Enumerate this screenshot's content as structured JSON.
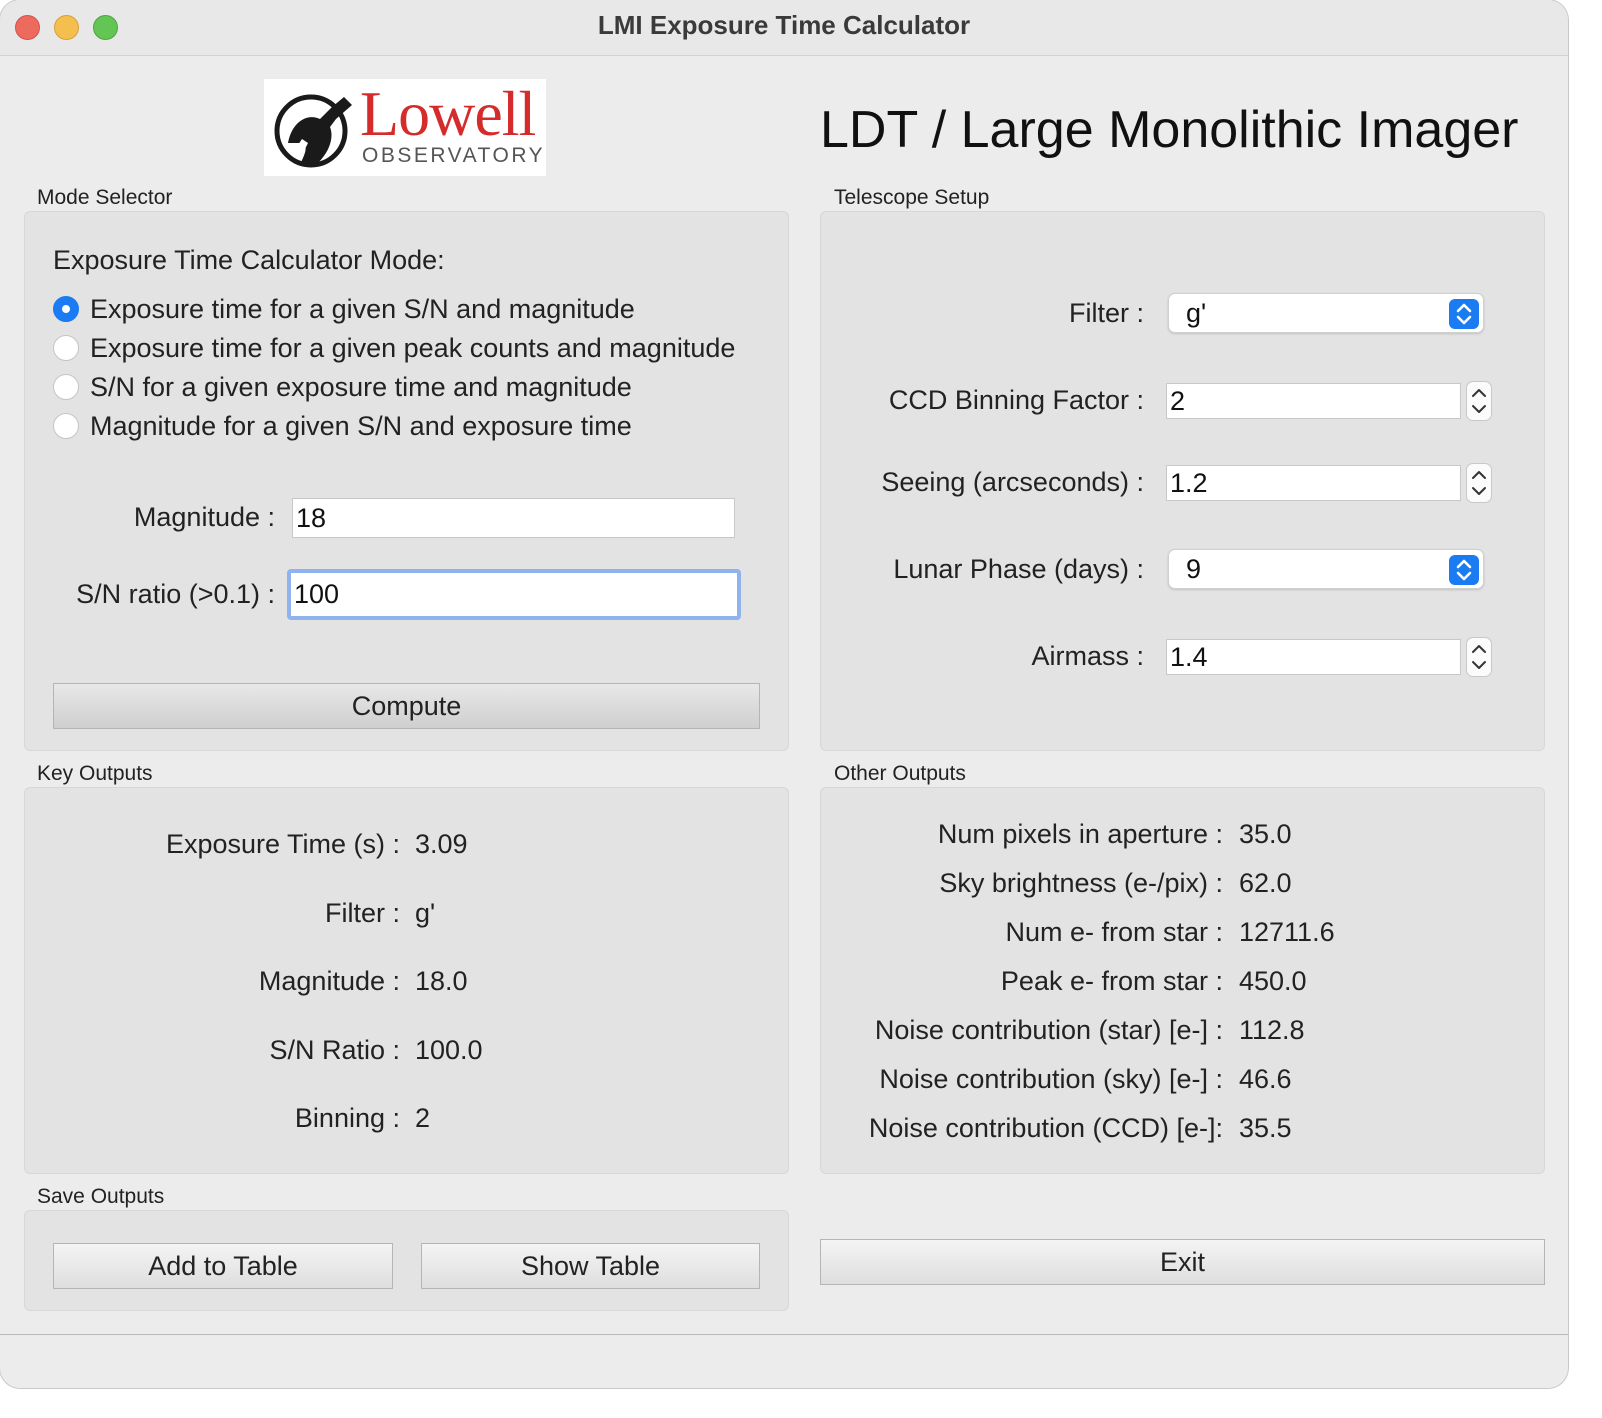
{
  "window": {
    "title": "LMI Exposure Time Calculator"
  },
  "header": {
    "logo_word": "Lowell",
    "logo_sub": "OBSERVATORY",
    "heading": "LDT / Large Monolithic Imager"
  },
  "mode_selector": {
    "group_label": "Mode Selector",
    "title": "Exposure Time Calculator Mode:",
    "options": [
      {
        "label": "Exposure time for a given S/N and magnitude",
        "checked": true
      },
      {
        "label": "Exposure time for a given peak counts and magnitude",
        "checked": false
      },
      {
        "label": "S/N for a given exposure time and magnitude",
        "checked": false
      },
      {
        "label": "Magnitude for a given S/N and exposure time",
        "checked": false
      }
    ],
    "magnitude_label": "Magnitude :",
    "magnitude_value": "18",
    "sn_label": "S/N ratio (>0.1) :",
    "sn_value": "100",
    "compute_label": "Compute"
  },
  "telescope_setup": {
    "group_label": "Telescope Setup",
    "filter_label": "Filter :",
    "filter_value": "g'",
    "binning_label": "CCD Binning Factor :",
    "binning_value": "2",
    "seeing_label": "Seeing (arcseconds) :",
    "seeing_value": "1.2",
    "lunar_label": "Lunar Phase (days) :",
    "lunar_value": "9",
    "airmass_label": "Airmass :",
    "airmass_value": "1.4"
  },
  "key_outputs": {
    "group_label": "Key Outputs",
    "rows": [
      {
        "label": "Exposure Time (s) :",
        "value": "3.09"
      },
      {
        "label": "Filter :",
        "value": "g'"
      },
      {
        "label": "Magnitude :",
        "value": "18.0"
      },
      {
        "label": "S/N Ratio :",
        "value": "100.0"
      },
      {
        "label": "Binning :",
        "value": "2"
      }
    ]
  },
  "other_outputs": {
    "group_label": "Other Outputs",
    "rows": [
      {
        "label": "Num pixels in aperture :",
        "value": "35.0"
      },
      {
        "label": "Sky brightness (e-/pix) :",
        "value": "62.0"
      },
      {
        "label": "Num e- from star :",
        "value": "12711.6"
      },
      {
        "label": "Peak e- from star :",
        "value": "450.0"
      },
      {
        "label": "Noise contribution (star) [e-] :",
        "value": "112.8"
      },
      {
        "label": "Noise contribution (sky) [e-] :",
        "value": "46.6"
      },
      {
        "label": "Noise contribution (CCD) [e-]:",
        "value": "35.5"
      }
    ]
  },
  "save_outputs": {
    "group_label": "Save Outputs",
    "add_label": "Add to Table",
    "show_label": "Show Table"
  },
  "exit_label": "Exit",
  "colors": {
    "accent": "#1a7bf2",
    "focus_ring": "#8fb3ee",
    "logo_red": "#d52b2b"
  }
}
